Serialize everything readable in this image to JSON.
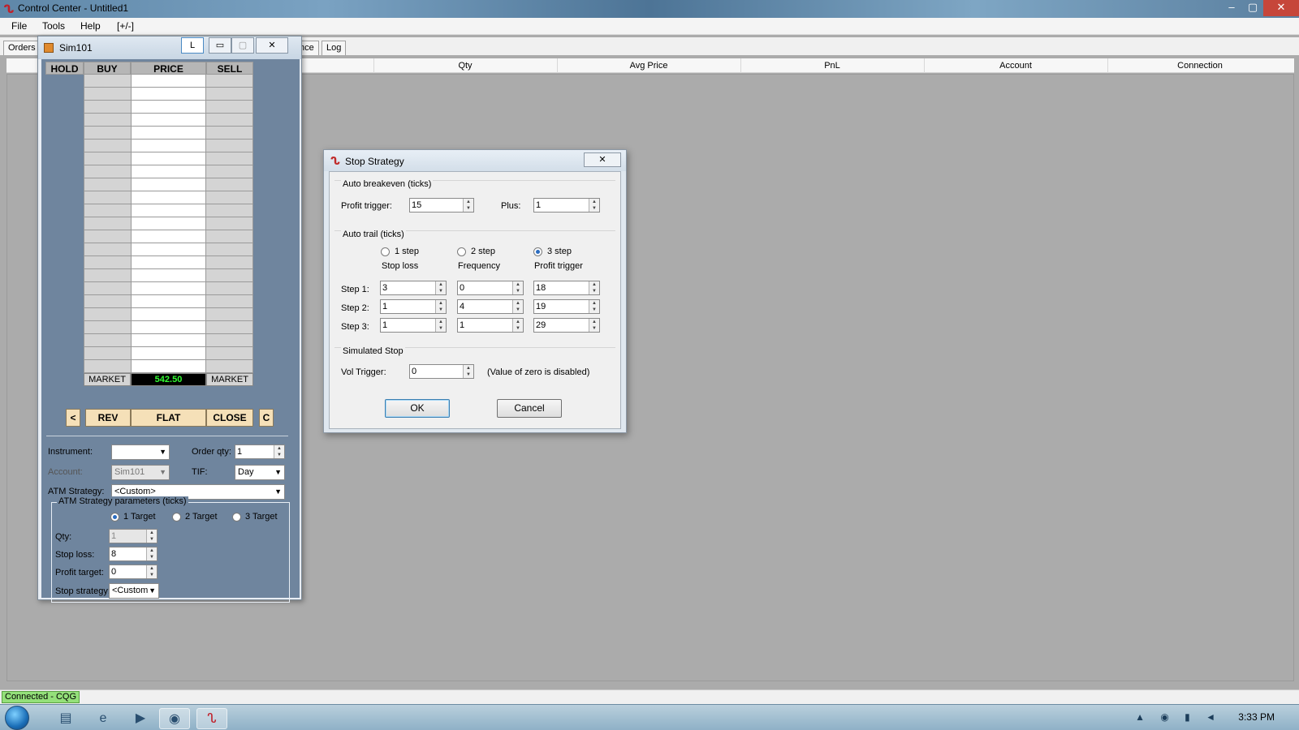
{
  "window": {
    "title": "Control Center - Untitled1",
    "controls": [
      "–",
      "▢",
      "✕"
    ]
  },
  "menu": [
    "File",
    "Tools",
    "Help",
    "[+/-]"
  ],
  "tabs": {
    "orders": "Orders",
    "performance_suffix": "nce",
    "log": "Log"
  },
  "positions_grid": {
    "columns": [
      "Qty",
      "Avg Price",
      "PnL",
      "Account",
      "Connection"
    ]
  },
  "status": {
    "connection": "Connected - CQG"
  },
  "taskbar": {
    "time": "3:33 PM",
    "tray_icons": "▲ ◉ ▮ ◄"
  },
  "sim_window": {
    "title": "Sim101",
    "buttons": {
      "lock": "L",
      "minimize": "▭",
      "maximize": "▢",
      "close": "✕"
    },
    "ladder": {
      "headers": [
        "HOLD",
        "BUY",
        "PRICE",
        "SELL"
      ],
      "market_left": "MARKET",
      "last_price": "542.50",
      "market_right": "MARKET",
      "rows": 23
    },
    "actions": {
      "prev": "<",
      "rev": "REV",
      "flat": "FLAT",
      "close": "CLOSE",
      "cancel": "C"
    },
    "form": {
      "instrument_label": "Instrument:",
      "instrument_value": "",
      "order_qty_label": "Order qty:",
      "order_qty_value": "1",
      "account_label": "Account:",
      "account_value": "Sim101",
      "tif_label": "TIF:",
      "tif_value": "Day",
      "atm_label": "ATM Strategy:",
      "atm_value": "<Custom>"
    },
    "atm_params": {
      "legend": "ATM Strategy parameters (ticks)",
      "targets": [
        "1 Target",
        "2 Target",
        "3 Target"
      ],
      "selected_target": 0,
      "qty_label": "Qty:",
      "qty_value": "1",
      "stop_loss_label": "Stop loss:",
      "stop_loss_value": "8",
      "profit_target_label": "Profit target:",
      "profit_target_value": "0",
      "stop_strategy_label": "Stop strategy:",
      "stop_strategy_value": "<Custom"
    }
  },
  "stop_strategy_dialog": {
    "title": "Stop Strategy",
    "close": "✕",
    "auto_breakeven": {
      "title": "Auto breakeven (ticks)",
      "profit_trigger_label": "Profit trigger:",
      "profit_trigger_value": "15",
      "plus_label": "Plus:",
      "plus_value": "1"
    },
    "auto_trail": {
      "title": "Auto trail (ticks)",
      "steps_options": [
        "1 step",
        "2 step",
        "3 step"
      ],
      "selected_step": 2,
      "col_headers": [
        "Stop loss",
        "Frequency",
        "Profit trigger"
      ],
      "rows": [
        {
          "label": "Step 1:",
          "stop_loss": "3",
          "frequency": "0",
          "profit_trigger": "18"
        },
        {
          "label": "Step 2:",
          "stop_loss": "1",
          "frequency": "4",
          "profit_trigger": "19"
        },
        {
          "label": "Step 3:",
          "stop_loss": "1",
          "frequency": "1",
          "profit_trigger": "29"
        }
      ]
    },
    "simulated_stop": {
      "title": "Simulated Stop",
      "vol_trigger_label": "Vol Trigger:",
      "vol_trigger_value": "0",
      "note": "(Value of zero is disabled)"
    },
    "ok": "OK",
    "cancel": "Cancel"
  },
  "colors": {
    "price_text": "#33ff33",
    "action_button": "#f5e0b8",
    "panel": "#6f859e"
  }
}
